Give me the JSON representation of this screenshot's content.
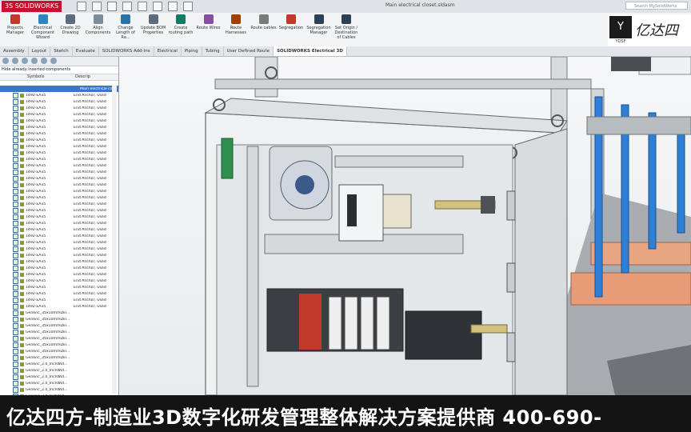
{
  "app": {
    "logo": "3S SOLIDWORKS",
    "doc_title": "Main electrical closet.sldasm",
    "search_placeholder": "Search MySolidWorks"
  },
  "ribbon": [
    {
      "label": "Projects Manager",
      "color": "#c0392b"
    },
    {
      "label": "Electrical Component Wizard",
      "color": "#2e86c1"
    },
    {
      "label": "Create 2D Drawing",
      "color": "#5d6d7e"
    },
    {
      "label": "Align Components",
      "color": "#7d8c96"
    },
    {
      "label": "Change Length of Ra...",
      "color": "#2874a6"
    },
    {
      "label": "Update BOM Properties",
      "color": "#5d6d7e"
    },
    {
      "label": "Create routing path",
      "color": "#117a65"
    },
    {
      "label": "Route Wires",
      "color": "#884ea0"
    },
    {
      "label": "Route Harnesses",
      "color": "#a04000"
    },
    {
      "label": "Route cables",
      "color": "#7b7d7d"
    },
    {
      "label": "Segregation",
      "color": "#c0392b"
    },
    {
      "label": "Segregation Manager",
      "color": "#2e4053"
    },
    {
      "label": "Set Origin / Destination of Cables",
      "color": "#2e4053"
    }
  ],
  "tabs": [
    "Assembly",
    "Layout",
    "Sketch",
    "Evaluate",
    "SOLIDWORKS Add-Ins",
    "Electrical",
    "Piping",
    "Tubing",
    "User Defined Route",
    "SOLIDWORKS Electrical 3D"
  ],
  "active_tab": "SOLIDWORKS Electrical 3D",
  "panel": {
    "hide_label": "Hide already inserted components",
    "col_symbols": "Symbols",
    "col_desc": "Descrip",
    "root_desc": "Main electrical clos",
    "rows": [
      {
        "sym": "1492-EA35",
        "desc": "End Anchor, Used"
      },
      {
        "sym": "1492-EA35",
        "desc": "End Anchor, Used"
      },
      {
        "sym": "1492-EA35",
        "desc": "End Anchor, Used"
      },
      {
        "sym": "1492-EA35",
        "desc": "End Anchor, Used"
      },
      {
        "sym": "1492-EA35",
        "desc": "End Anchor, Used"
      },
      {
        "sym": "1492-EA35",
        "desc": "End Anchor, Used"
      },
      {
        "sym": "1492-EA35",
        "desc": "End Anchor, Used"
      },
      {
        "sym": "1492-EA35",
        "desc": "End Anchor, Used"
      },
      {
        "sym": "1492-EA35",
        "desc": "End Anchor, Used"
      },
      {
        "sym": "1492-EA35",
        "desc": "End Anchor, Used"
      },
      {
        "sym": "1492-EA35",
        "desc": "End Anchor, Used"
      },
      {
        "sym": "1492-EA35",
        "desc": "End Anchor, Used"
      },
      {
        "sym": "1492-EA35",
        "desc": "End Anchor, Used"
      },
      {
        "sym": "1492-EA35",
        "desc": "End Anchor, Used"
      },
      {
        "sym": "1492-EA35",
        "desc": "End Anchor, Used"
      },
      {
        "sym": "1492-EA35",
        "desc": "End Anchor, Used"
      },
      {
        "sym": "1492-EA35",
        "desc": "End Anchor, Used"
      },
      {
        "sym": "1492-EA35",
        "desc": "End Anchor, Used"
      },
      {
        "sym": "1492-EA35",
        "desc": "End Anchor, Used"
      },
      {
        "sym": "1492-EA35",
        "desc": "End Anchor, Used"
      },
      {
        "sym": "1492-EA35",
        "desc": "End Anchor, Used"
      },
      {
        "sym": "1492-EA35",
        "desc": "End Anchor, Used"
      },
      {
        "sym": "1492-EA35",
        "desc": "End Anchor, Used"
      },
      {
        "sym": "1492-EA35",
        "desc": "End Anchor, Used"
      },
      {
        "sym": "1492-EA35",
        "desc": "End Anchor, Used"
      },
      {
        "sym": "1492-EA35",
        "desc": "End Anchor, Used"
      },
      {
        "sym": "1492-EA35",
        "desc": "End Anchor, Used"
      },
      {
        "sym": "1492-EA35",
        "desc": "End Anchor, Used"
      },
      {
        "sym": "1492-EA35",
        "desc": "End Anchor, Used"
      },
      {
        "sym": "1492-EA35",
        "desc": "End Anchor, Used"
      },
      {
        "sym": "1492-EA35",
        "desc": "End Anchor, Used"
      },
      {
        "sym": "1492-EA35",
        "desc": "End Anchor, Used"
      },
      {
        "sym": "1492-EA35",
        "desc": "End Anchor, Used"
      },
      {
        "sym": "1492-EA35",
        "desc": "End Anchor, Used"
      },
      {
        "sym": "Generic_35x10mmDin...",
        "desc": ""
      },
      {
        "sym": "Generic_35x10mmDin...",
        "desc": ""
      },
      {
        "sym": "Generic_35x10mmDin...",
        "desc": ""
      },
      {
        "sym": "Generic_35x10mmDin...",
        "desc": ""
      },
      {
        "sym": "Generic_35x10mmDin...",
        "desc": ""
      },
      {
        "sym": "Generic_35x10mmDin...",
        "desc": ""
      },
      {
        "sym": "Generic_35x10mmDin...",
        "desc": ""
      },
      {
        "sym": "Generic_35x10mmDin...",
        "desc": ""
      },
      {
        "sym": "Generic_2.0_InchWid...",
        "desc": ""
      },
      {
        "sym": "Generic_2.0_InchWid...",
        "desc": ""
      },
      {
        "sym": "Generic_2.0_InchWid...",
        "desc": ""
      },
      {
        "sym": "Generic_2.0_InchWid...",
        "desc": ""
      },
      {
        "sym": "Generic_2.0_InchWid...",
        "desc": ""
      },
      {
        "sym": "Generic_2.0_InchWid...",
        "desc": ""
      }
    ]
  },
  "banner": "亿达四方-制造业3D数字化研发管理整体解决方案提供商  400-690-",
  "watermark": {
    "logo": "Y",
    "sub": "YDSF",
    "text": "亿达四"
  },
  "colors": {
    "banner_bg": "#141414",
    "accent": "#3a77c8",
    "cabinet": "#f0f1f2",
    "rods": "#2f7fd6",
    "copper": "#e79b77"
  }
}
